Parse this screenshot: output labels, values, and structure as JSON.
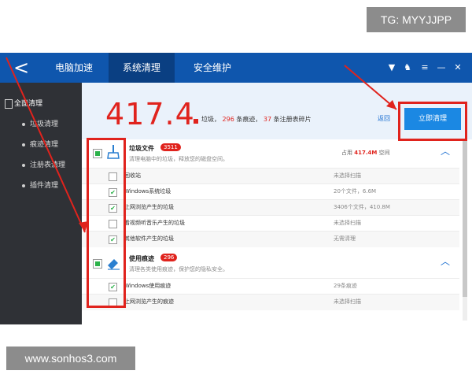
{
  "watermarks": {
    "top": "TG: MYYJJPP",
    "bottom": "www.sonhos3.com"
  },
  "titlebar": {
    "back": "<",
    "tabs": [
      {
        "label": "电脑加速"
      },
      {
        "label": "系统清理"
      },
      {
        "label": "安全维护"
      }
    ],
    "controls": [
      "▼",
      "♞",
      "≡",
      "—",
      "✕"
    ]
  },
  "sidebar": {
    "items": [
      {
        "label": "全面清理"
      },
      {
        "label": "垃圾清理"
      },
      {
        "label": "痕迹清理"
      },
      {
        "label": "注册表清理"
      },
      {
        "label": "插件清理"
      }
    ]
  },
  "summary": {
    "size": "417.4",
    "label_garbage": "垃圾，",
    "traces_count": "296",
    "label_traces": "条痕迹，",
    "registry_count": "37",
    "label_registry": "条注册表碎片",
    "rescan": "返回",
    "clean_button": "立即清理"
  },
  "categories": [
    {
      "title": "垃圾文件",
      "badge": "3511",
      "desc": "清理电脑中的垃圾，释放您的磁盘空间。",
      "right_prefix": "占用",
      "right_value": "417.4M",
      "right_suffix": "空间",
      "rows": [
        {
          "name": "回收站",
          "stat": "未选择扫描",
          "checked": false
        },
        {
          "name": "Windows系统垃圾",
          "stat": "20个文件，6.6M",
          "checked": true
        },
        {
          "name": "上网浏览产生的垃圾",
          "stat": "3406个文件，410.8M",
          "checked": true
        },
        {
          "name": "看视频听音乐产生的垃圾",
          "stat": "未选择扫描",
          "checked": false
        },
        {
          "name": "其他软件产生的垃圾",
          "stat": "无需清理",
          "checked": true
        }
      ]
    },
    {
      "title": "使用痕迹",
      "badge": "296",
      "desc": "清理各类使用痕迹，保护您的隐私安全。",
      "rows": [
        {
          "name": "Windows使用痕迹",
          "stat": "29条痕迹",
          "checked": true
        },
        {
          "name": "上网浏览产生的痕迹",
          "stat": "未选择扫描",
          "checked": false
        }
      ]
    }
  ],
  "colors": {
    "titlebar": "#0f56ad",
    "sidebar": "#2f3136",
    "accent_red": "#e0231d",
    "button_blue": "#1b88e3",
    "check_green": "#2cb24a"
  }
}
